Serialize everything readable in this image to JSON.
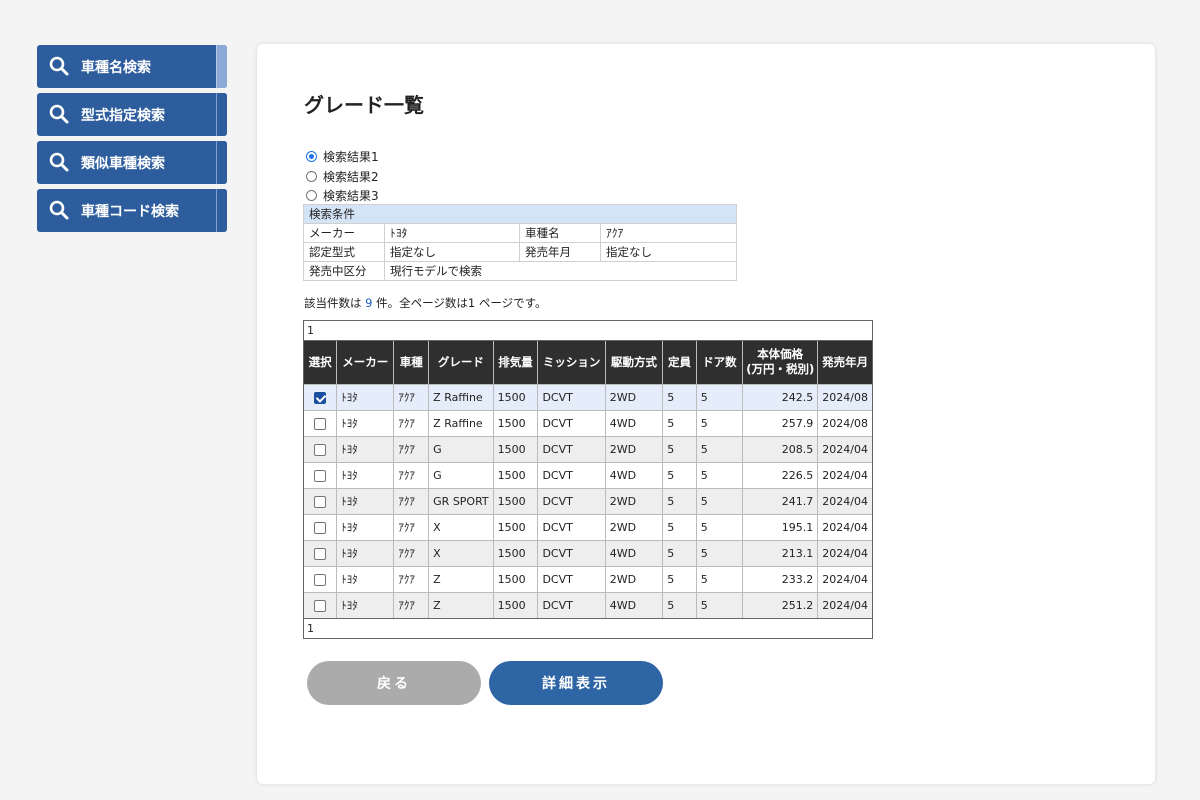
{
  "sidebar": {
    "items": [
      {
        "label": "車種名検索",
        "icon": "search-icon"
      },
      {
        "label": "型式指定検索",
        "icon": "search-icon"
      },
      {
        "label": "類似車種検索",
        "icon": "search-icon"
      },
      {
        "label": "車種コード検索",
        "icon": "search-icon"
      }
    ]
  },
  "main": {
    "title": "グレード一覧",
    "result_sets": [
      {
        "label": "検索結果1",
        "selected": true
      },
      {
        "label": "検索結果2",
        "selected": false
      },
      {
        "label": "検索結果3",
        "selected": false
      }
    ],
    "conditions": {
      "header": "検索条件",
      "maker_label": "メーカー",
      "maker_value": "ﾄﾖﾀ",
      "model_label": "車種名",
      "model_value": "ｱｸｱ",
      "type_label": "認定型式",
      "type_value": "指定なし",
      "release_label": "発売年月",
      "release_value": "指定なし",
      "status_label": "発売中区分",
      "status_value": "現行モデルで検索"
    },
    "summary": {
      "prefix": "該当件数は ",
      "count": "9",
      "middle": " 件。全ページ数は",
      "pages": "1",
      "suffix": " ページです。"
    },
    "pager_top": "1",
    "pager_bottom": "1",
    "columns": [
      "選択",
      "メーカー",
      "車種",
      "グレード",
      "排気量",
      "ミッション",
      "駆動方式",
      "定員",
      "ドア数",
      "本体価格",
      "(万円・税別)",
      "発売年月"
    ],
    "rows": [
      {
        "checked": true,
        "maker": "ﾄﾖﾀ",
        "model": "ｱｸｱ",
        "grade": "Z Raffine",
        "cc": "1500",
        "mission": "DCVT",
        "drive": "2WD",
        "seats": "5",
        "doors": "5",
        "price": "242.5",
        "release": "2024/08"
      },
      {
        "checked": false,
        "maker": "ﾄﾖﾀ",
        "model": "ｱｸｱ",
        "grade": "Z Raffine",
        "cc": "1500",
        "mission": "DCVT",
        "drive": "4WD",
        "seats": "5",
        "doors": "5",
        "price": "257.9",
        "release": "2024/08"
      },
      {
        "checked": false,
        "maker": "ﾄﾖﾀ",
        "model": "ｱｸｱ",
        "grade": "G",
        "cc": "1500",
        "mission": "DCVT",
        "drive": "2WD",
        "seats": "5",
        "doors": "5",
        "price": "208.5",
        "release": "2024/04"
      },
      {
        "checked": false,
        "maker": "ﾄﾖﾀ",
        "model": "ｱｸｱ",
        "grade": "G",
        "cc": "1500",
        "mission": "DCVT",
        "drive": "4WD",
        "seats": "5",
        "doors": "5",
        "price": "226.5",
        "release": "2024/04"
      },
      {
        "checked": false,
        "maker": "ﾄﾖﾀ",
        "model": "ｱｸｱ",
        "grade": "GR SPORT",
        "cc": "1500",
        "mission": "DCVT",
        "drive": "2WD",
        "seats": "5",
        "doors": "5",
        "price": "241.7",
        "release": "2024/04"
      },
      {
        "checked": false,
        "maker": "ﾄﾖﾀ",
        "model": "ｱｸｱ",
        "grade": "X",
        "cc": "1500",
        "mission": "DCVT",
        "drive": "2WD",
        "seats": "5",
        "doors": "5",
        "price": "195.1",
        "release": "2024/04"
      },
      {
        "checked": false,
        "maker": "ﾄﾖﾀ",
        "model": "ｱｸｱ",
        "grade": "X",
        "cc": "1500",
        "mission": "DCVT",
        "drive": "4WD",
        "seats": "5",
        "doors": "5",
        "price": "213.1",
        "release": "2024/04"
      },
      {
        "checked": false,
        "maker": "ﾄﾖﾀ",
        "model": "ｱｸｱ",
        "grade": "Z",
        "cc": "1500",
        "mission": "DCVT",
        "drive": "2WD",
        "seats": "5",
        "doors": "5",
        "price": "233.2",
        "release": "2024/04"
      },
      {
        "checked": false,
        "maker": "ﾄﾖﾀ",
        "model": "ｱｸｱ",
        "grade": "Z",
        "cc": "1500",
        "mission": "DCVT",
        "drive": "4WD",
        "seats": "5",
        "doors": "5",
        "price": "251.2",
        "release": "2024/04"
      }
    ],
    "buttons": {
      "back": "戻る",
      "detail": "詳細表示"
    }
  }
}
